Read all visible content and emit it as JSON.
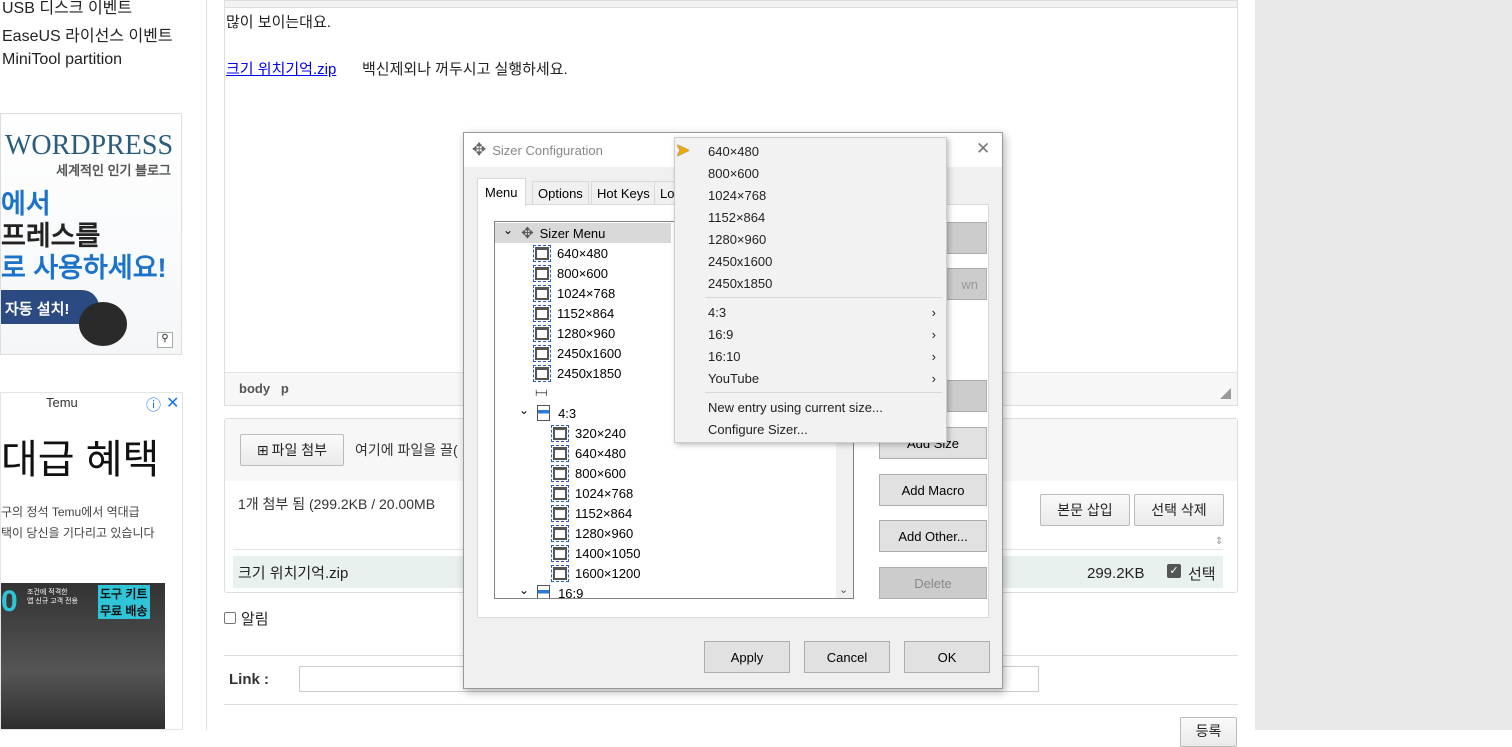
{
  "sidebar": {
    "links": [
      "USB 디스크 이벤트",
      "EaseUS 라이선스 이벤트",
      "MiniTool partition"
    ],
    "ad_wordpress": {
      "logo": "WORDPRESS",
      "tagline": "세계적인 인기 블로그",
      "line1": "에서",
      "line2": "프레스를",
      "line3": "로 사용하세요!",
      "button": "자동 설치!"
    },
    "ad_temu": {
      "brand": "Temu",
      "headline": "대급 혜택",
      "desc1": "구의 정석 Temu에서 역대급",
      "desc2": "택이 당신을 기다리고 있습니다",
      "banner_small1": "조건에 적격한",
      "banner_small2": "앱 신규 고객 전용",
      "banner_big1": "도구 키트",
      "banner_big2": "무료 배송"
    }
  },
  "editor": {
    "line1": "많이 보이는대요.",
    "link": "크기 위치기억.zip",
    "line2": "백신제외나 꺼두시고 실행하세요.",
    "status_tags": [
      "body",
      "p"
    ]
  },
  "attach": {
    "button": "파일 첨부",
    "drop_hint": "여기에 파일을 끌(",
    "summary": "1개 첨부 됨 (299.2KB / 20.00MB",
    "insert": "본문 삽입",
    "delete_selected": "선택 삭제",
    "file_name": "크기 위치기억.zip",
    "file_size": "299.2KB",
    "select_label": "선택",
    "select_checked": true
  },
  "notify_label": "알림",
  "link_label": "Link :",
  "submit": "등록",
  "dialog": {
    "title": "Sizer Configuration",
    "tabs": [
      "Menu",
      "Options",
      "Hot Keys",
      "Lo"
    ],
    "tree": [
      {
        "label": "Sizer Menu",
        "type": "root",
        "level": 0
      },
      {
        "label": "640×480",
        "level": 1
      },
      {
        "label": "800×600",
        "level": 1
      },
      {
        "label": "1024×768",
        "level": 1
      },
      {
        "label": "1152×864",
        "level": 1
      },
      {
        "label": "1280×960",
        "level": 1
      },
      {
        "label": "2450x1600",
        "level": 1
      },
      {
        "label": "2450x1850",
        "level": 1
      },
      {
        "label": "",
        "type": "separator",
        "level": 1
      },
      {
        "label": "4:3",
        "type": "group",
        "level": 1
      },
      {
        "label": "320×240",
        "level": 2
      },
      {
        "label": "640×480",
        "level": 2
      },
      {
        "label": "800×600",
        "level": 2
      },
      {
        "label": "1024×768",
        "level": 2
      },
      {
        "label": "1152×864",
        "level": 2
      },
      {
        "label": "1280×960",
        "level": 2
      },
      {
        "label": "1400×1050",
        "level": 2
      },
      {
        "label": "1600×1200",
        "level": 2
      },
      {
        "label": "16:9",
        "type": "group",
        "level": 1
      }
    ],
    "side_buttons": [
      "",
      "wn",
      "",
      "Add Size",
      "Add Macro",
      "Add Other...",
      "Delete"
    ],
    "footer": [
      "Apply",
      "Cancel",
      "OK"
    ]
  },
  "context_menu": {
    "sizes": [
      "640×480",
      "800×600",
      "1024×768",
      "1152×864",
      "1280×960",
      "2450x1600",
      "2450x1850"
    ],
    "submenus": [
      "4:3",
      "16:9",
      "16:10",
      "YouTube"
    ],
    "actions": [
      "New entry using current size...",
      "Configure Sizer..."
    ]
  }
}
